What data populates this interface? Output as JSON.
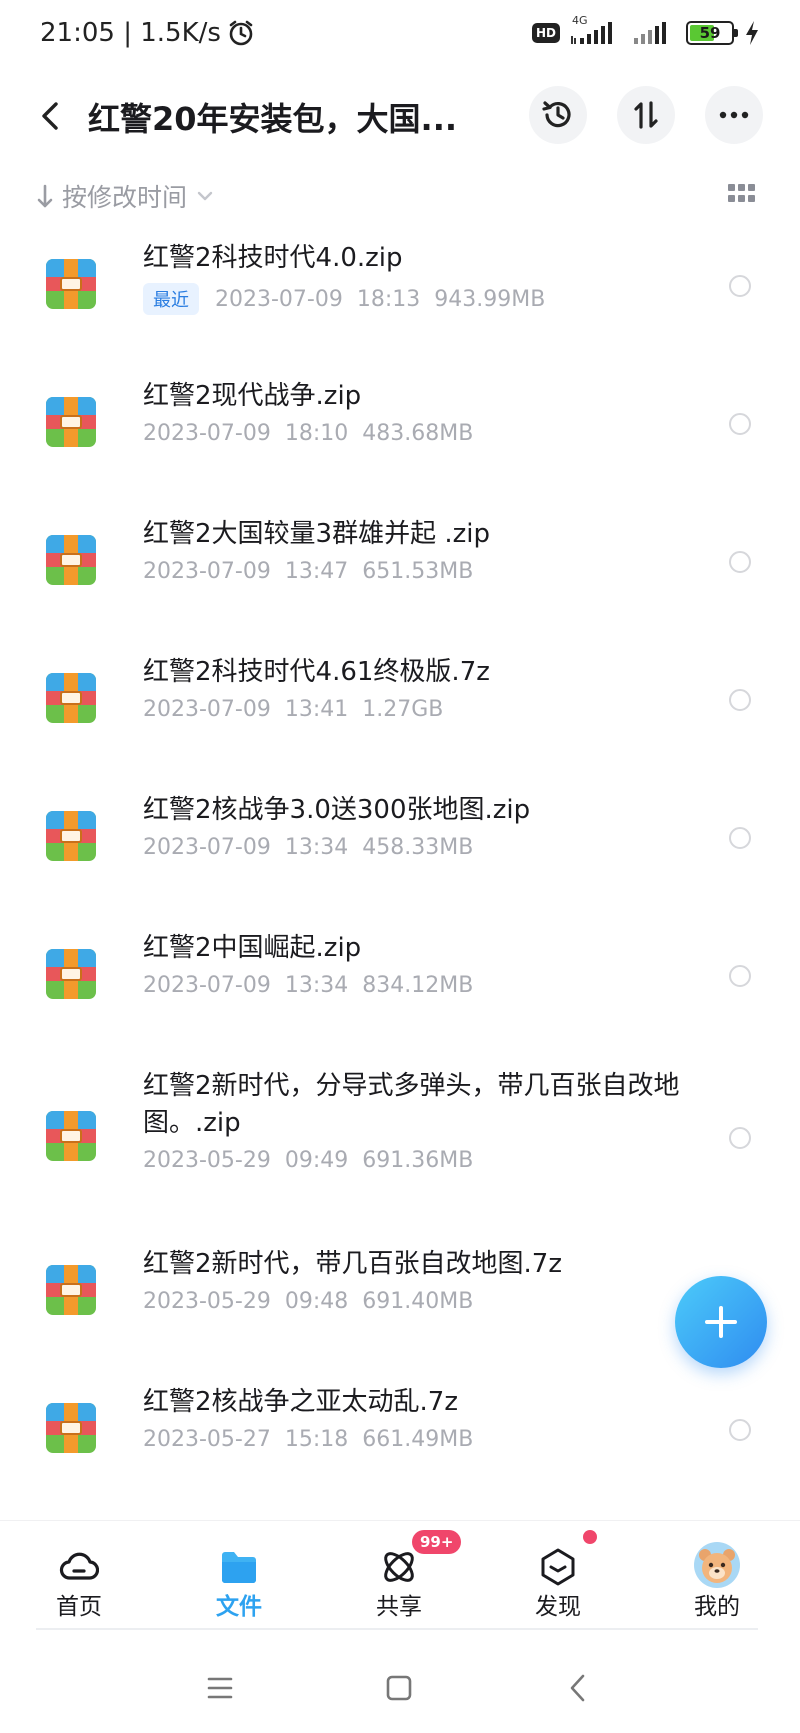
{
  "status_bar": {
    "time_speed": "21:05 | 1.5K/s",
    "hd": "HD",
    "network": "4G",
    "battery": "59",
    "battery_level": 0.59
  },
  "header": {
    "title": "红警20年安装包，大国..."
  },
  "sort": {
    "label": "按修改时间"
  },
  "files": [
    {
      "name": "红警2科技时代4.0.zip",
      "tag": "最近",
      "date": "2023-07-09",
      "time": "18:13",
      "size": "943.99MB"
    },
    {
      "name": "红警2现代战争.zip",
      "tag": "",
      "date": "2023-07-09",
      "time": "18:10",
      "size": "483.68MB"
    },
    {
      "name": "红警2大国较量3群雄并起 .zip",
      "tag": "",
      "date": "2023-07-09",
      "time": "13:47",
      "size": "651.53MB"
    },
    {
      "name": "红警2科技时代4.61终极版.7z",
      "tag": "",
      "date": "2023-07-09",
      "time": "13:41",
      "size": "1.27GB"
    },
    {
      "name": "红警2核战争3.0送300张地图.zip",
      "tag": "",
      "date": "2023-07-09",
      "time": "13:34",
      "size": "458.33MB"
    },
    {
      "name": "红警2中国崛起.zip",
      "tag": "",
      "date": "2023-07-09",
      "time": "13:34",
      "size": "834.12MB"
    },
    {
      "name": "红警2新时代，分导式多弹头，带几百张自改地图。.zip",
      "tag": "",
      "date": "2023-05-29",
      "time": "09:49",
      "size": "691.36MB"
    },
    {
      "name": "红警2新时代，带几百张自改地图.7z",
      "tag": "",
      "date": "2023-05-29",
      "time": "09:48",
      "size": "691.40MB"
    },
    {
      "name": "红警2核战争之亚太动乱.7z",
      "tag": "",
      "date": "2023-05-27",
      "time": "15:18",
      "size": "661.49MB"
    }
  ],
  "bottom_nav": {
    "home": "首页",
    "files": "文件",
    "share": "共享",
    "share_badge": "99+",
    "discover": "发现",
    "mine": "我的"
  },
  "colors": {
    "accent": "#2da2f0",
    "fab_start": "#4ccbfa",
    "fab_end": "#2f8cf0",
    "badge": "#f0466b",
    "zip_red": "#e8575a",
    "zip_blue": "#3fa9e6",
    "zip_green": "#6cc04a",
    "zip_orange": "#f39a2c"
  },
  "icons": {
    "back": "back-arrow-icon",
    "history": "history-icon",
    "sort_toggle": "sort-toggle-icon",
    "more": "more-icon",
    "grid": "grid-view-icon",
    "fab": "plus-icon"
  }
}
